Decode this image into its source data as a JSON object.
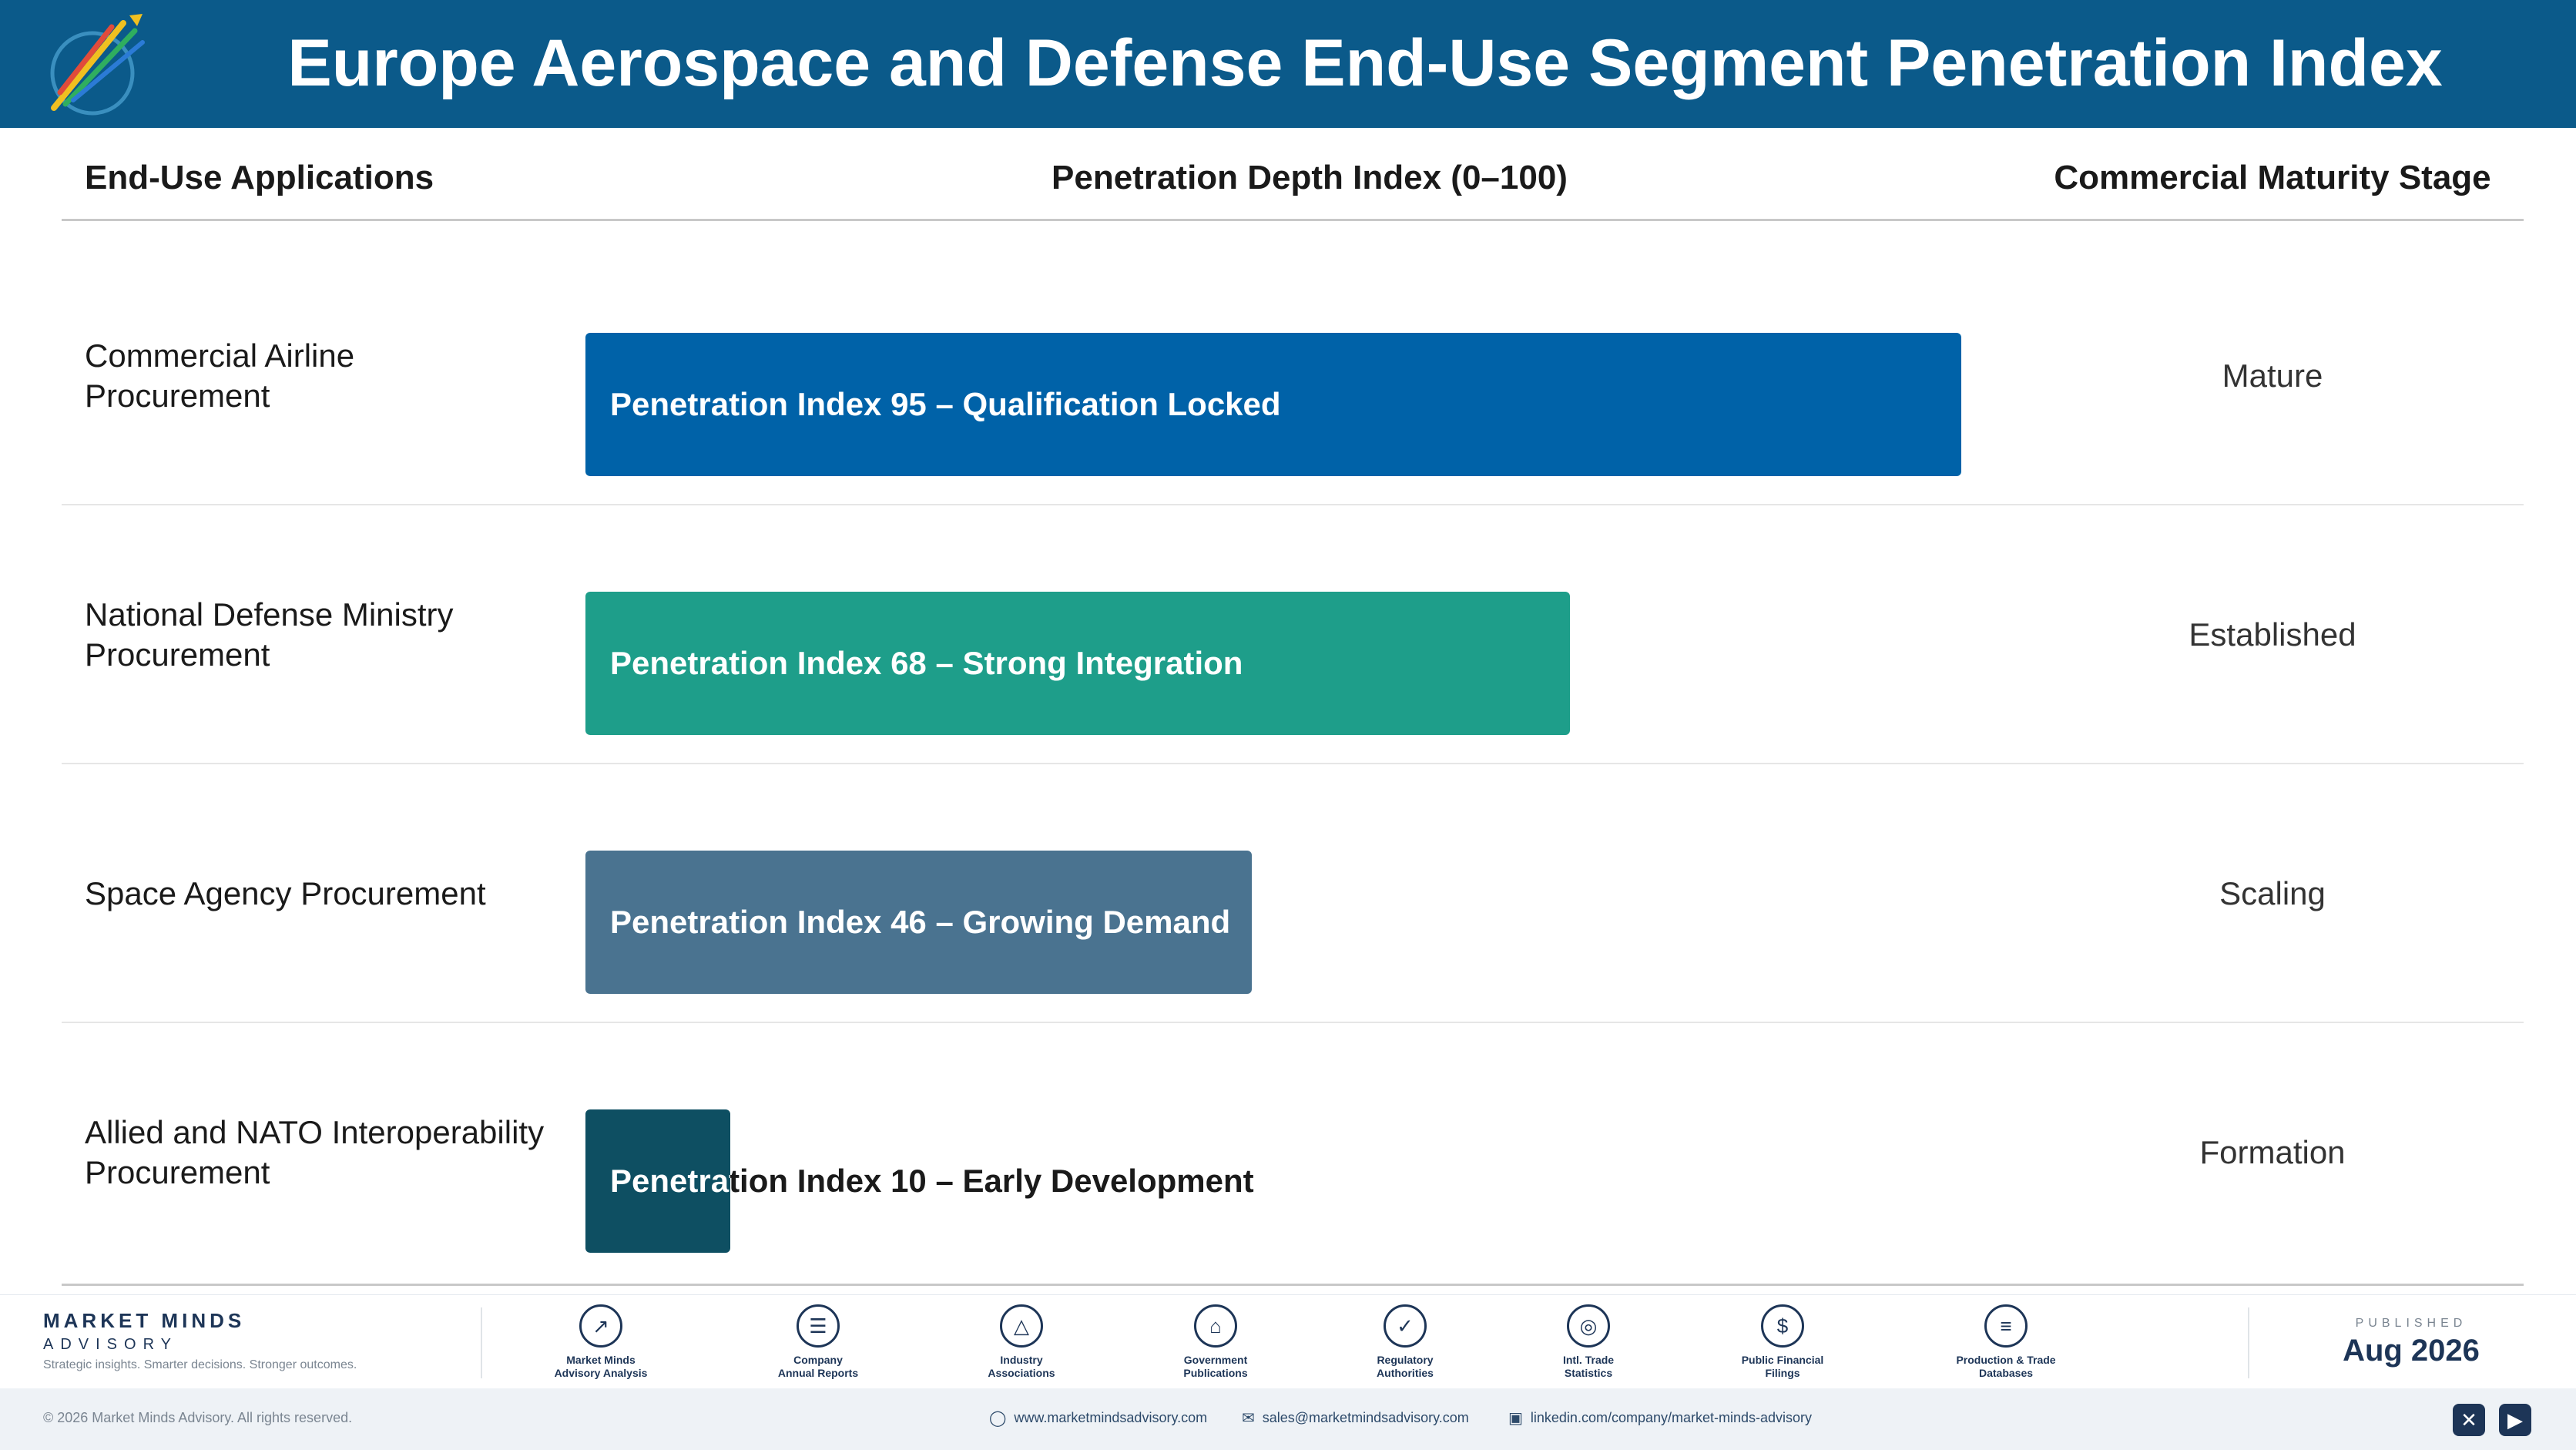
{
  "header": {
    "title": "Europe Aerospace and Defense End-Use Segment Penetration Index"
  },
  "columns": {
    "applications": "End-Use Applications",
    "index": "Penetration Depth Index (0–100)",
    "stage": "Commercial Maturity Stage"
  },
  "chart_data": {
    "type": "bar",
    "orientation": "horizontal",
    "title": "Europe Aerospace and Defense End-Use Segment Penetration Index",
    "xlim": [
      0,
      100
    ],
    "categories": [
      "Commercial Airline Procurement",
      "National Defense Ministry Procurement",
      "Space Agency Procurement",
      "Allied and NATO Interoperability Procurement"
    ],
    "values": [
      95,
      68,
      46,
      10
    ],
    "bar_labels": [
      "Penetration Index 95 – Qualification Locked",
      "Penetration Index 68 – Strong Integration",
      "Penetration Index 46 – Growing Demand",
      "Penetration Index 10 – Early Development"
    ],
    "stages": [
      "Mature",
      "Established",
      "Scaling",
      "Formation"
    ],
    "colors": [
      "#0062a8",
      "#1e9e8a",
      "#4a7390",
      "#0e4f62"
    ]
  },
  "footer": {
    "brand_name": "MARKET MINDS",
    "brand_sub": "ADVISORY",
    "brand_tagline": "Strategic insights. Smarter decisions. Stronger outcomes.",
    "sources": [
      {
        "icon": "analysis-icon",
        "label1": "Market Minds",
        "label2": "Advisory Analysis"
      },
      {
        "icon": "report-icon",
        "label1": "Company",
        "label2": "Annual Reports"
      },
      {
        "icon": "network-icon",
        "label1": "Industry",
        "label2": "Associations"
      },
      {
        "icon": "government-icon",
        "label1": "Government",
        "label2": "Publications"
      },
      {
        "icon": "shield-icon",
        "label1": "Regulatory",
        "label2": "Authorities"
      },
      {
        "icon": "globe-icon",
        "label1": "Intl. Trade",
        "label2": "Statistics"
      },
      {
        "icon": "dollar-icon",
        "label1": "Public Financial",
        "label2": "Filings"
      },
      {
        "icon": "database-icon",
        "label1": "Production & Trade",
        "label2": "Databases"
      }
    ],
    "published_label": "PUBLISHED",
    "published_date": "Aug 2026",
    "copyright": "© 2026 Market Minds Advisory. All rights reserved.",
    "website": "www.marketmindsadvisory.com",
    "email": "sales@marketmindsadvisory.com",
    "linkedin": "linkedin.com/company/market-minds-advisory"
  }
}
